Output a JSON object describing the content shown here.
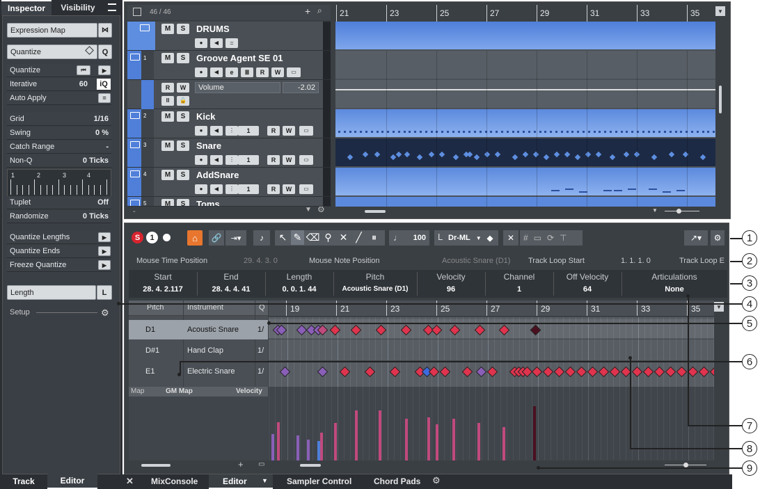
{
  "inspector": {
    "tabs": [
      "Inspector",
      "Visibility"
    ],
    "menu_icon": "hamburger-icon",
    "expression_map": "Expression Map",
    "quantize_header": "Quantize",
    "rows": [
      {
        "label": "Quantize",
        "value": ""
      },
      {
        "label": "Iterative",
        "value": "60"
      },
      {
        "label": "Auto Apply",
        "value": ""
      },
      {
        "label": "Grid",
        "value": "1/16"
      },
      {
        "label": "Swing",
        "value": "0 %"
      },
      {
        "label": "Catch Range",
        "value": "-"
      },
      {
        "label": "Non-Q",
        "value": "0 Ticks"
      }
    ],
    "grid_numbers": [
      "1",
      "2",
      "3",
      "4"
    ],
    "rows2": [
      {
        "label": "Tuplet",
        "value": "Off"
      },
      {
        "label": "Randomize",
        "value": "0 Ticks"
      }
    ],
    "rows3": [
      "Quantize Lengths",
      "Quantize Ends",
      "Freeze Quantize"
    ],
    "iq_label": "iQ",
    "length_label": "Length",
    "length_btn": "L",
    "setup_label": "Setup",
    "bottom_tabs": [
      "Track",
      "Editor"
    ]
  },
  "project": {
    "track_count": "46 / 46",
    "ruler": [
      "21",
      "23",
      "25",
      "27",
      "29",
      "31",
      "33",
      "35"
    ],
    "tracks": [
      {
        "name": "DRUMS",
        "num": ""
      },
      {
        "name": "Groove Agent SE 01",
        "num": "1"
      },
      {
        "name": "Kick",
        "num": "2"
      },
      {
        "name": "Snare",
        "num": "3"
      },
      {
        "name": "AddSnare",
        "num": "4"
      },
      {
        "name": "Toms",
        "num": "5"
      }
    ],
    "automation": {
      "param": "Volume",
      "value": "-2.02"
    },
    "midi_channel": "1",
    "m": "M",
    "s": "S",
    "r": "R",
    "w": "W"
  },
  "editor": {
    "toolbar": {
      "velocity": "100",
      "drum_map_sel": "Dr-ML",
      "solo": "S",
      "one": "1"
    },
    "status_bar": {
      "mouse_time_label": "Mouse Time Position",
      "mouse_time_value": "29. 4. 3.    0",
      "mouse_note_label": "Mouse Note Position",
      "mouse_note_value": "Acoustic Snare (D1)",
      "track_loop_start_label": "Track Loop Start",
      "track_loop_start_value": "1. 1. 1.    0",
      "track_loop_end_label": "Track Loop E"
    },
    "info_line": {
      "headers": [
        "Start",
        "End",
        "Length",
        "Pitch",
        "Velocity",
        "Channel",
        "Off Velocity",
        "Articulations"
      ],
      "values": [
        "28. 4. 2.117",
        "28. 4. 4. 41",
        "0. 0. 1. 44",
        "Acoustic Snare (D1)",
        "96",
        "1",
        "64",
        "None"
      ]
    },
    "drum_list": {
      "headers": [
        "Pitch",
        "Instrument",
        "Q"
      ],
      "rows": [
        {
          "pitch": "D1",
          "instrument": "Acoustic Snare",
          "q": "1/"
        },
        {
          "pitch": "D#1",
          "instrument": "Hand Clap",
          "q": "1/"
        },
        {
          "pitch": "E1",
          "instrument": "Electric Snare",
          "q": "1/"
        }
      ]
    },
    "ruler": [
      "19",
      "21",
      "23",
      "25",
      "27",
      "29",
      "31",
      "33",
      "35"
    ],
    "lane_footer": {
      "map_label": "Map",
      "map_value": "GM Map",
      "controller": "Velocity"
    }
  },
  "bottom_tabs": [
    "MixConsole",
    "Editor",
    "Sampler Control",
    "Chord Pads"
  ],
  "callouts": [
    "1",
    "2",
    "3",
    "4",
    "5",
    "6",
    "7",
    "8",
    "9"
  ],
  "colors": {
    "accent_blue": "#4f7fd9",
    "note_red": "#e0344e",
    "note_purple": "#8a5fb8",
    "solo_red": "#d8242e"
  }
}
